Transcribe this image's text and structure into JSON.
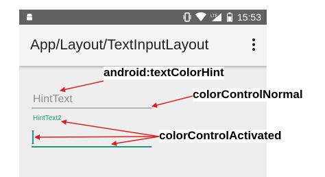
{
  "status_bar": {
    "time": "15:53",
    "icons": [
      "android-icon",
      "vibrate-icon",
      "wifi-icon",
      "lte-signal-icon",
      "battery-icon"
    ]
  },
  "app_bar": {
    "title": "App/Layout/TextInputLayout",
    "overflow_icon": "more-vert-icon"
  },
  "form": {
    "field1_hint": "HintText",
    "field2_floating_hint": "HintText2"
  },
  "annotations": {
    "text_color_hint": "android:textColorHint",
    "color_control_normal": "colorControlNormal",
    "color_control_activated": "colorControlActivated"
  },
  "colors": {
    "accent": "#1c9a80",
    "control_normal": "#8a8a8a",
    "hint_text": "#8e8e8e",
    "arrow": "#e02020",
    "status_bar": "#616161",
    "app_bar": "#f5f5f5",
    "background": "#eeeeee"
  }
}
